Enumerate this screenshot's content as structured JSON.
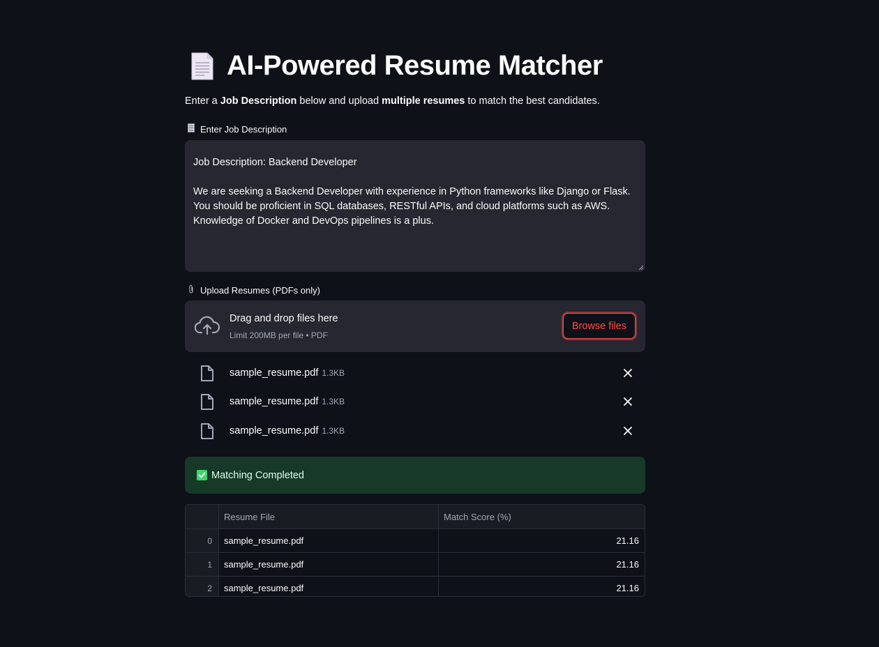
{
  "header": {
    "emoji": "page-facing-up-icon",
    "title": "AI-Powered Resume Matcher"
  },
  "intro": {
    "part1": "Enter a ",
    "bold1": "Job Description",
    "part2": " below and upload ",
    "bold2": "multiple resumes",
    "part3": " to match the best candidates."
  },
  "job_description": {
    "label_icon": "receipt-icon",
    "label": "Enter Job Description",
    "value": "Job Description: Backend Developer\n\nWe are seeking a Backend Developer with experience in Python frameworks like Django or Flask.\nYou should be proficient in SQL databases, RESTful APIs, and cloud platforms such as AWS.\nKnowledge of Docker and DevOps pipelines is a plus."
  },
  "uploader": {
    "label_icon": "paperclip-icon",
    "label": "Upload Resumes (PDFs only)",
    "drop_title": "Drag and drop files here",
    "drop_subtitle": "Limit 200MB per file • PDF",
    "browse_label": "Browse files",
    "files": [
      {
        "name": "sample_resume.pdf",
        "size": "1.3KB"
      },
      {
        "name": "sample_resume.pdf",
        "size": "1.3KB"
      },
      {
        "name": "sample_resume.pdf",
        "size": "1.3KB"
      }
    ]
  },
  "status": {
    "icon": "check-mark-icon",
    "text": "Matching Completed",
    "color": "#173928"
  },
  "results_table": {
    "columns": [
      "",
      "Resume File",
      "Match Score (%)"
    ],
    "rows": [
      {
        "index": "0",
        "file": "sample_resume.pdf",
        "score": "21.16"
      },
      {
        "index": "1",
        "file": "sample_resume.pdf",
        "score": "21.16"
      },
      {
        "index": "2",
        "file": "sample_resume.pdf",
        "score": "21.16"
      }
    ]
  },
  "colors": {
    "background": "#0e1117",
    "input_bg": "#262730",
    "accent": "#ff4b4b",
    "success_bg": "#173928",
    "success_icon": "#3dd56d"
  }
}
